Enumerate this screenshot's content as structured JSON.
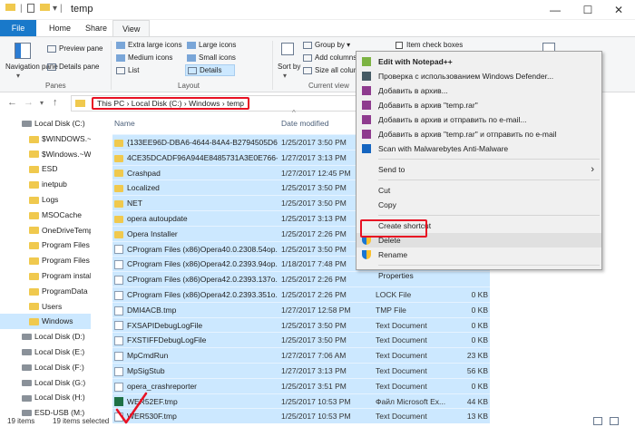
{
  "window": {
    "title": "temp",
    "controls": {
      "minimize": "—",
      "maximize": "☐",
      "close": "✕"
    }
  },
  "ribbon_tabs": [
    "File",
    "Home",
    "Share",
    "View"
  ],
  "ribbon": {
    "navigation_pane": "Navigation pane",
    "preview_pane": "Preview pane",
    "details_pane": "Details pane",
    "panes_group": "Panes",
    "layout": [
      "Extra large icons",
      "Large icons",
      "Medium icons",
      "Small icons",
      "List",
      "Details"
    ],
    "layout_group": "Layout",
    "sort_by": "Sort by",
    "group_by": "Group by",
    "add_columns": "Add columns",
    "size_all_columns": "Size all columns",
    "current_view_group": "Current view",
    "item_check_boxes": "Item check boxes"
  },
  "address": {
    "crumbs": "This PC  ›  Local Disk (C:)  ›  Windows  ›  temp"
  },
  "nav": [
    {
      "label": "Local Disk (C:)",
      "icon": "drive"
    },
    {
      "label": "$WINDOWS.~B",
      "icon": "folder"
    },
    {
      "label": "$Windows.~W",
      "icon": "folder"
    },
    {
      "label": "ESD",
      "icon": "folder"
    },
    {
      "label": "inetpub",
      "icon": "folder"
    },
    {
      "label": "Logs",
      "icon": "folder"
    },
    {
      "label": "MSOCache",
      "icon": "folder"
    },
    {
      "label": "OneDriveTemp",
      "icon": "folder"
    },
    {
      "label": "Program Files",
      "icon": "folder"
    },
    {
      "label": "Program Files (",
      "icon": "folder"
    },
    {
      "label": "Program instal",
      "icon": "folder"
    },
    {
      "label": "ProgramData",
      "icon": "folder"
    },
    {
      "label": "Users",
      "icon": "folder"
    },
    {
      "label": "Windows",
      "icon": "folder",
      "selected": true
    },
    {
      "label": "Local Disk (D:)",
      "icon": "drive"
    },
    {
      "label": "Local Disk (E:)",
      "icon": "drive"
    },
    {
      "label": "Local Disk (F:)",
      "icon": "drive"
    },
    {
      "label": "Local Disk (G:)",
      "icon": "drive"
    },
    {
      "label": "Local Disk (H:)",
      "icon": "drive"
    },
    {
      "label": "ESD-USB (M:)",
      "icon": "drive"
    }
  ],
  "columns": {
    "name": "Name",
    "date": "Date modified"
  },
  "files": [
    {
      "name": "{133EE96D-DBA6-4644-84A4-B2794505D6...",
      "date": "1/25/2017 3:50 PM",
      "type": "",
      "size": "",
      "icon": "folder"
    },
    {
      "name": "4CE35DCADF96A944E8485731A3E0E766-S...",
      "date": "1/27/2017 3:13 PM",
      "type": "",
      "size": "",
      "icon": "folder"
    },
    {
      "name": "Crashpad",
      "date": "1/27/2017 12:45 PM",
      "type": "",
      "size": "",
      "icon": "folder"
    },
    {
      "name": "Localized",
      "date": "1/25/2017 3:50 PM",
      "type": "",
      "size": "",
      "icon": "folder"
    },
    {
      "name": "NET",
      "date": "1/25/2017 3:50 PM",
      "type": "",
      "size": "",
      "icon": "folder"
    },
    {
      "name": "opera autoupdate",
      "date": "1/25/2017 3:13 PM",
      "type": "",
      "size": "",
      "icon": "folder"
    },
    {
      "name": "Opera Installer",
      "date": "1/25/2017 2:26 PM",
      "type": "",
      "size": "",
      "icon": "folder"
    },
    {
      "name": "CProgram Files (x86)Opera40.0.2308.54op...",
      "date": "1/25/2017 3:50 PM",
      "type": "",
      "size": "",
      "icon": "file"
    },
    {
      "name": "CProgram Files (x86)Opera42.0.2393.94op...",
      "date": "1/18/2017 7:48 PM",
      "type": "",
      "size": "",
      "icon": "file"
    },
    {
      "name": "CProgram Files (x86)Opera42.0.2393.137o...",
      "date": "1/25/2017 2:26 PM",
      "type": "",
      "size": "",
      "icon": "file"
    },
    {
      "name": "CProgram Files (x86)Opera42.0.2393.351o...",
      "date": "1/25/2017 2:26 PM",
      "type": "LOCK File",
      "size": "0 KB",
      "icon": "file"
    },
    {
      "name": "DMI4ACB.tmp",
      "date": "1/27/2017 12:58 PM",
      "type": "TMP File",
      "size": "0 KB",
      "icon": "file"
    },
    {
      "name": "FXSAPIDebugLogFile",
      "date": "1/25/2017 3:50 PM",
      "type": "Text Document",
      "size": "0 KB",
      "icon": "file"
    },
    {
      "name": "FXSTIFFDebugLogFile",
      "date": "1/25/2017 3:50 PM",
      "type": "Text Document",
      "size": "0 KB",
      "icon": "file"
    },
    {
      "name": "MpCmdRun",
      "date": "1/27/2017 7:06 AM",
      "type": "Text Document",
      "size": "23 KB",
      "icon": "file"
    },
    {
      "name": "MpSigStub",
      "date": "1/27/2017 3:13 PM",
      "type": "Text Document",
      "size": "56 KB",
      "icon": "file"
    },
    {
      "name": "opera_crashreporter",
      "date": "1/25/2017 3:51 PM",
      "type": "Text Document",
      "size": "0 KB",
      "icon": "file"
    },
    {
      "name": "WER52EF.tmp",
      "date": "1/25/2017 10:53 PM",
      "type": "Файл Microsoft Ex...",
      "size": "44 KB",
      "icon": "xl"
    },
    {
      "name": "WER530F.tmp",
      "date": "1/25/2017 10:53 PM",
      "type": "Text Document",
      "size": "13 KB",
      "icon": "file"
    }
  ],
  "status": {
    "items": "19 items",
    "selected": "19 items selected"
  },
  "context_menu": [
    {
      "label": "Edit with Notepad++",
      "bold": true,
      "icon": "notepad"
    },
    {
      "label": "Проверка с использованием Windows Defender...",
      "icon": "defender"
    },
    {
      "label": "Добавить в архив...",
      "icon": "rar"
    },
    {
      "label": "Добавить в архив \"temp.rar\"",
      "icon": "rar"
    },
    {
      "label": "Добавить в архив и отправить по e-mail...",
      "icon": "rar"
    },
    {
      "label": "Добавить в архив \"temp.rar\" и отправить по e-mail",
      "icon": "rar"
    },
    {
      "label": "Scan with Malwarebytes Anti-Malware",
      "icon": "malwarebytes"
    },
    {
      "sep": true
    },
    {
      "label": "Send to",
      "submenu": true
    },
    {
      "sep": true
    },
    {
      "label": "Cut"
    },
    {
      "label": "Copy"
    },
    {
      "sep": true
    },
    {
      "label": "Create shortcut"
    },
    {
      "label": "Delete",
      "icon": "shield",
      "highlight": true
    },
    {
      "label": "Rename",
      "icon": "shield"
    },
    {
      "sep": true
    },
    {
      "label": "Properties"
    }
  ],
  "colors": {
    "selection": "#cce8ff",
    "accent": "#1979ca",
    "annotation_red": "#e81123"
  }
}
